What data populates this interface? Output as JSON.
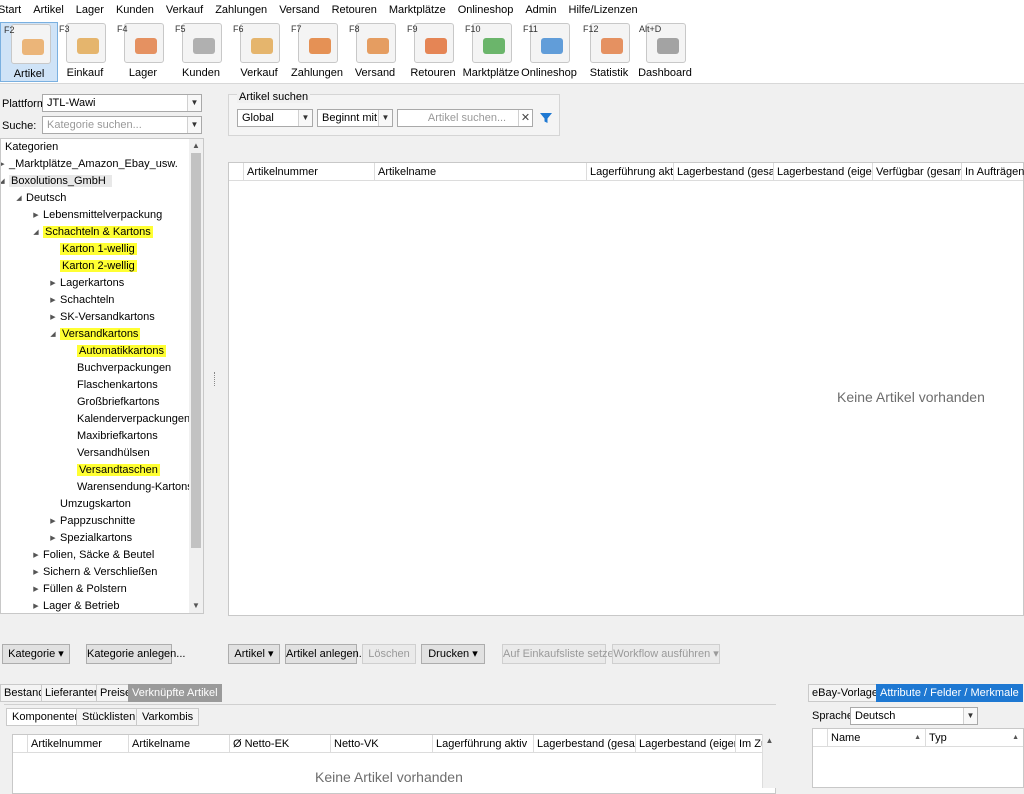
{
  "menu": [
    "Start",
    "Artikel",
    "Lager",
    "Kunden",
    "Verkauf",
    "Zahlungen",
    "Versand",
    "Retouren",
    "Marktplätze",
    "Onlineshop",
    "Admin",
    "Hilfe/Lizenzen"
  ],
  "toolbar": [
    {
      "key": "F2",
      "label": "Artikel",
      "icon": "article-icon",
      "active": true
    },
    {
      "key": "F3",
      "label": "Einkauf",
      "icon": "purchase-icon"
    },
    {
      "key": "F4",
      "label": "Lager",
      "icon": "warehouse-icon"
    },
    {
      "key": "F5",
      "label": "Kunden",
      "icon": "customers-icon"
    },
    {
      "key": "F6",
      "label": "Verkauf",
      "icon": "sales-icon"
    },
    {
      "key": "F7",
      "label": "Zahlungen",
      "icon": "payments-icon"
    },
    {
      "key": "F8",
      "label": "Versand",
      "icon": "shipping-icon"
    },
    {
      "key": "F9",
      "label": "Retouren",
      "icon": "returns-icon"
    },
    {
      "key": "F10",
      "label": "Marktplätze",
      "icon": "marketplaces-icon"
    },
    {
      "key": "F11",
      "label": "Onlineshop",
      "icon": "onlineshop-icon"
    },
    {
      "key": "F12",
      "label": "Statistik",
      "icon": "statistics-icon"
    },
    {
      "key": "Alt+D",
      "label": "Dashboard",
      "icon": "dashboard-icon"
    }
  ],
  "left": {
    "platform_label": "Plattform:",
    "platform_value": "JTL-Wawi",
    "search_label": "Suche:",
    "search_placeholder": "Kategorie suchen...",
    "tree_header": "Kategorien",
    "tree": [
      {
        "label": "_Marktplätze_Amazon_Ebay_usw.",
        "toggle": "▶",
        "hl": false
      },
      {
        "label": "Boxolutions_GmbH",
        "toggle": "◢",
        "hl": false,
        "sel": true
      },
      {
        "label": "Deutsch",
        "toggle": "◢",
        "hl": false
      },
      {
        "label": "Lebensmittelverpackung",
        "toggle": "▶",
        "hl": false
      },
      {
        "label": "Schachteln & Kartons",
        "toggle": "◢",
        "hl": true
      },
      {
        "label": "Karton 1-wellig",
        "toggle": "",
        "hl": true
      },
      {
        "label": "Karton 2-wellig",
        "toggle": "",
        "hl": true
      },
      {
        "label": "Lagerkartons",
        "toggle": "▶",
        "hl": false
      },
      {
        "label": "Schachteln",
        "toggle": "▶",
        "hl": false
      },
      {
        "label": "SK-Versandkartons",
        "toggle": "▶",
        "hl": false
      },
      {
        "label": "Versandkartons",
        "toggle": "◢",
        "hl": true
      },
      {
        "label": "Automatikkartons",
        "toggle": "",
        "hl": true
      },
      {
        "label": "Buchverpackungen",
        "toggle": "",
        "hl": false
      },
      {
        "label": "Flaschenkartons",
        "toggle": "",
        "hl": false
      },
      {
        "label": "Großbriefkartons",
        "toggle": "",
        "hl": false
      },
      {
        "label": "Kalenderverpackungen",
        "toggle": "",
        "hl": false
      },
      {
        "label": "Maxibriefkartons",
        "toggle": "",
        "hl": false
      },
      {
        "label": "Versandhülsen",
        "toggle": "",
        "hl": false
      },
      {
        "label": "Versandtaschen",
        "toggle": "",
        "hl": true
      },
      {
        "label": "Warensendung-Kartons",
        "toggle": "",
        "hl": false
      },
      {
        "label": "Umzugskarton",
        "toggle": "",
        "hl": false
      },
      {
        "label": "Pappzuschnitte",
        "toggle": "▶",
        "hl": false
      },
      {
        "label": "Spezialkartons",
        "toggle": "▶",
        "hl": false
      },
      {
        "label": "Folien, Säcke & Beutel",
        "toggle": "▶",
        "hl": false
      },
      {
        "label": "Sichern & Verschließen",
        "toggle": "▶",
        "hl": false
      },
      {
        "label": "Füllen & Polstern",
        "toggle": "▶",
        "hl": false
      },
      {
        "label": "Lager & Betrieb",
        "toggle": "▶",
        "hl": false
      }
    ],
    "btn_kategorie": "Kategorie",
    "btn_kategorie_anlegen": "Kategorie anlegen..."
  },
  "main": {
    "search_group_title": "Artikel suchen",
    "scope": "Global",
    "mode": "Beginnt mit",
    "search_placeholder": "Artikel suchen...",
    "columns": [
      "Artikelnummer",
      "Artikelname",
      "Lagerführung aktiv",
      "Lagerbestand (gesamt)",
      "Lagerbestand (eigen)",
      "Verfügbar (gesamt)",
      "In Aufträgen"
    ],
    "empty": "Keine Artikel vorhanden",
    "buttons": [
      "Artikel",
      "Artikel anlegen...",
      "Löschen",
      "Drucken",
      "Auf Einkaufsliste setzen...",
      "Workflow ausführen"
    ]
  },
  "bottom": {
    "tabs": [
      "Bestand",
      "Lieferanten",
      "Preise",
      "Verknüpfte Artikel"
    ],
    "subtabs": [
      "Komponenten",
      "Stücklisten",
      "Varkombis"
    ],
    "columns": [
      "Artikelnummer",
      "Artikelname",
      "Ø Netto-EK",
      "Netto-VK",
      "Lagerführung aktiv",
      "Lagerbestand (gesamt)",
      "Lagerbestand (eigen)",
      "Im Zu"
    ],
    "empty": "Keine Artikel vorhanden"
  },
  "right": {
    "tabs": [
      "eBay-Vorlagen",
      "Attribute / Felder / Merkmale"
    ],
    "lang_label": "Sprache:",
    "lang_value": "Deutsch",
    "columns": [
      "Name",
      "Typ"
    ]
  },
  "colors": {
    "highlight": "#ffff32",
    "accent": "#1e78d2",
    "active_tool": "#cfe3f7"
  }
}
